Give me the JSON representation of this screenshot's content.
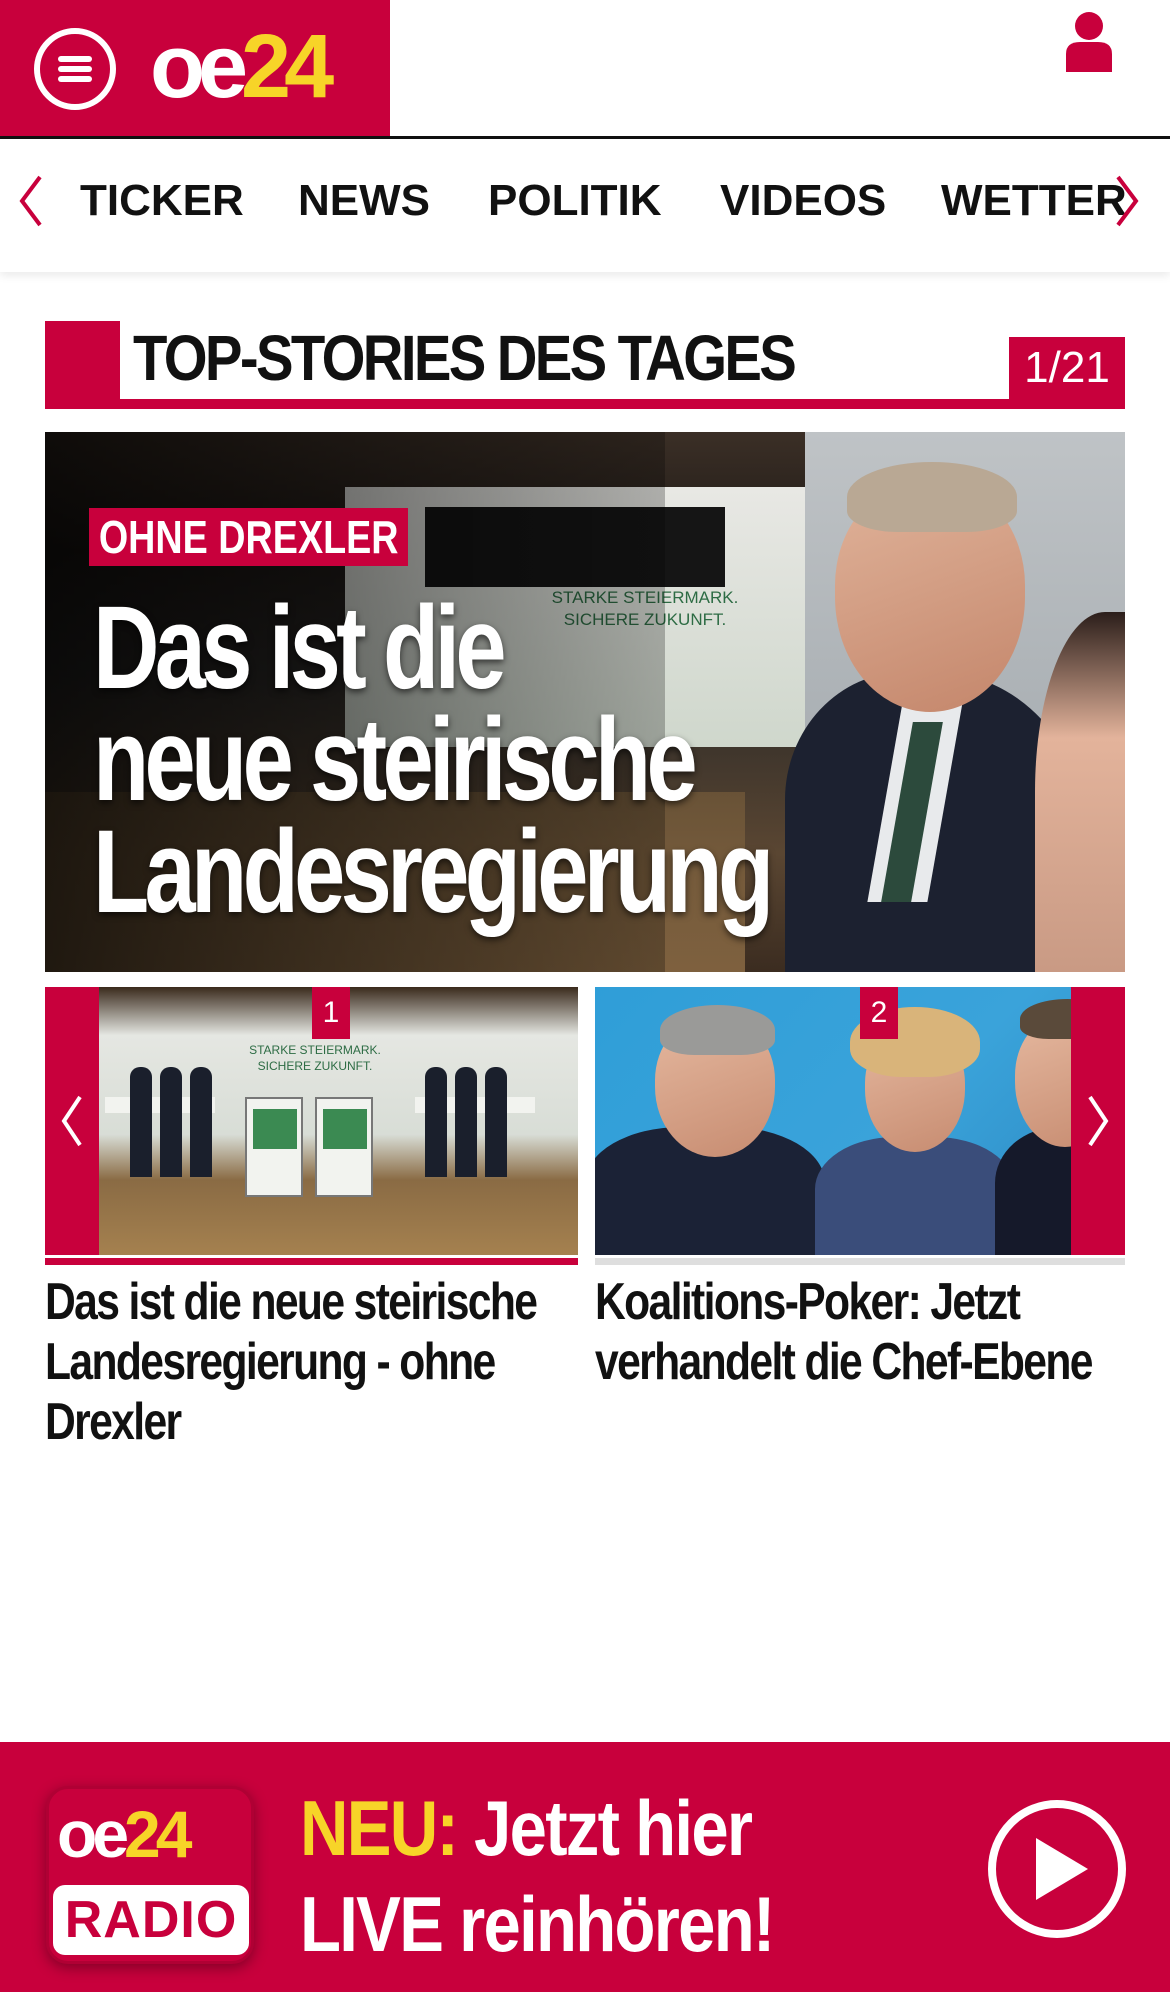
{
  "header": {
    "logo_main": "oe",
    "logo_number": "24",
    "brand_colors": {
      "primary": "#c8003c",
      "accent": "#f7d428"
    },
    "menu_icon": "hamburger-menu-icon",
    "user_icon": "user-icon"
  },
  "nav": {
    "items": [
      {
        "label": "TICKER"
      },
      {
        "label": "NEWS"
      },
      {
        "label": "POLITIK"
      },
      {
        "label": "VIDEOS"
      },
      {
        "label": "WETTER"
      }
    ],
    "prev_icon": "chevron-left-icon",
    "next_icon": "chevron-right-icon"
  },
  "section": {
    "title": "TOP-STORIES DES TAGES",
    "counter": "1/21"
  },
  "hero": {
    "kicker": "OHNE DREXLER",
    "headline_lines": [
      "Das ist die",
      "neue steirische",
      "Landesregierung"
    ],
    "backdrop_text_1": "STARKE STEIERMARK.",
    "backdrop_text_2": "SICHERE ZUKUNFT."
  },
  "carousel": {
    "items": [
      {
        "number": "1",
        "title": "Das ist die neue steirische Landesregierung - ohne Drexler",
        "active": true
      },
      {
        "number": "2",
        "title": "Koalitions-Poker: Jetzt verhandelt die Chef-Ebene",
        "active": false
      }
    ],
    "prev_icon": "chevron-left-icon",
    "next_icon": "chevron-right-icon"
  },
  "radio_banner": {
    "logo_main": "oe",
    "logo_number": "24",
    "logo_sub": "RADIO",
    "highlight": "NEU:",
    "text_line1": " Jetzt hier",
    "text_line2": "LIVE reinhören!",
    "play_icon": "play-icon"
  }
}
